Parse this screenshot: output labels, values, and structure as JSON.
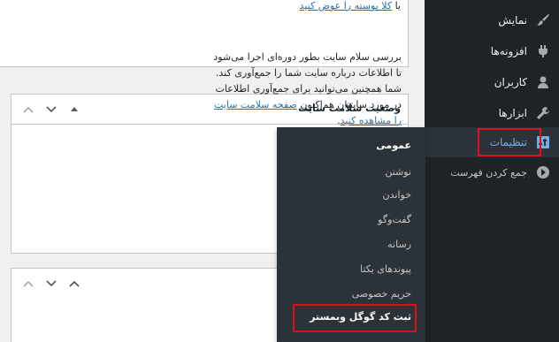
{
  "top_card": {
    "line_prefix": "یا",
    "line_link": "کلا پوسته را عوض کنید"
  },
  "widget": {
    "title": "وضعیت سلامت سایت",
    "body_line1": "بررسی سلام سایت بطور دوره‌ای اجرا می‌شود",
    "body_line2": "تا اطلاعات درباره سایت شما را جمع‌آوری کند.",
    "body_line3": "شما همچنین می‌توانید برای جمع‌آوری اطلاعات",
    "body_line4": "در مورد سایتتان هم‌اکنون",
    "body_link1": "صفحه سلامت سایت",
    "body_link2": "را مشاهده کنید",
    "body_end": "."
  },
  "sidebar": {
    "items": [
      {
        "label": "نمایش",
        "icon": "brush-icon"
      },
      {
        "label": "افزونه‌ها",
        "icon": "plugin-icon"
      },
      {
        "label": "کاربران",
        "icon": "user-icon"
      },
      {
        "label": "ابزارها",
        "icon": "wrench-icon"
      },
      {
        "label": "تنظیمات",
        "icon": "settings-icon"
      },
      {
        "label": "جمع کردن فهرست",
        "icon": "collapse-icon"
      }
    ]
  },
  "flyout": {
    "items": [
      {
        "label": "عمومی"
      },
      {
        "label": "نوشتن"
      },
      {
        "label": "خواندن"
      },
      {
        "label": "گفت‌وگو"
      },
      {
        "label": "رسانه"
      },
      {
        "label": "پیوندهای یکتا"
      },
      {
        "label": "حریم خصوصی"
      },
      {
        "label": "ثبت کد گوگل وبمستر"
      }
    ]
  },
  "colors": {
    "sidebar_bg": "#1d2327",
    "flyout_bg": "#2c3338",
    "link": "#2271b1",
    "current": "#72aee6",
    "highlight": "#e0101b"
  }
}
